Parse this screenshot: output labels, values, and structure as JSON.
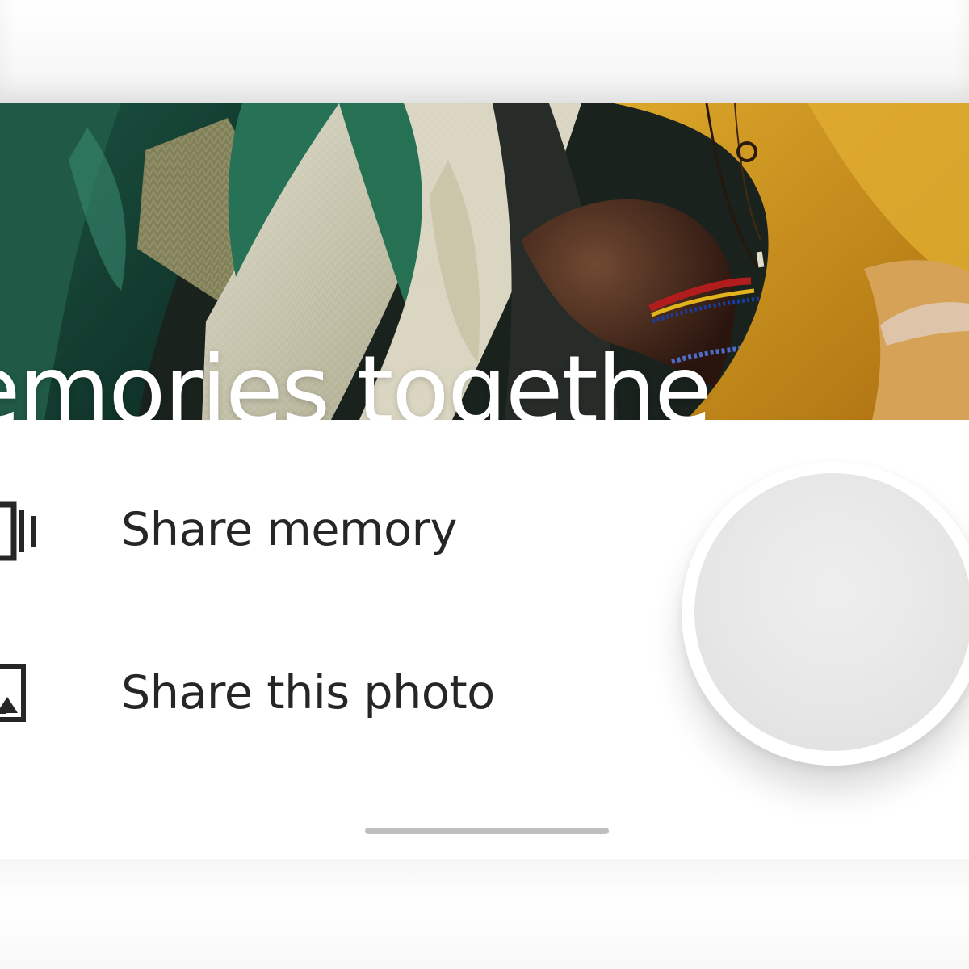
{
  "hero": {
    "visible_title_fragment": "emories togethe"
  },
  "share_sheet": {
    "items": [
      {
        "label": "Share memory",
        "icon": "memory-stack-icon"
      },
      {
        "label": "Share this photo",
        "icon": "image-icon"
      }
    ]
  },
  "colors": {
    "sheet_background": "#ffffff",
    "text": "#262626",
    "handle": "#bfbfbf",
    "touch_indicator": "#e8e8e8"
  }
}
